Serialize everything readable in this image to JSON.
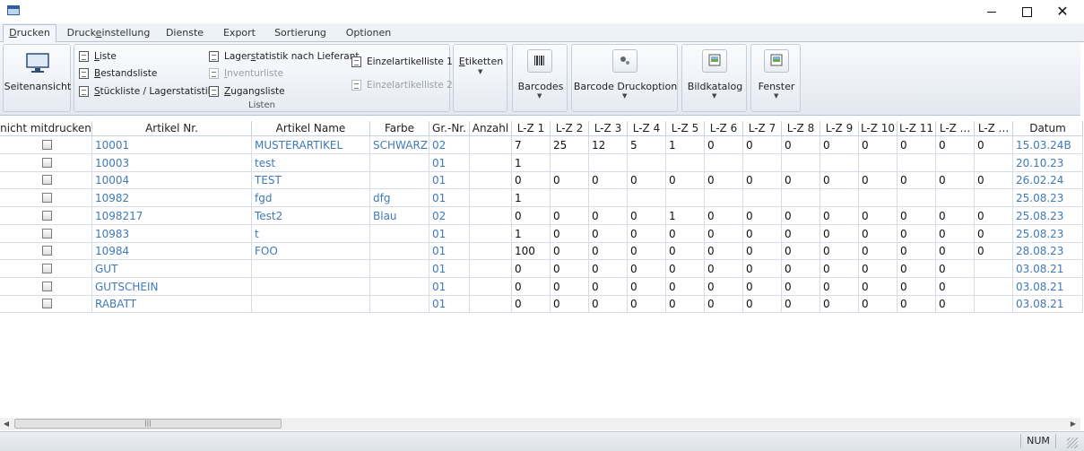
{
  "window": {
    "minimize_glyph": "",
    "maximize_glyph": "",
    "close_glyph": "✕"
  },
  "tabs": [
    {
      "pre": "",
      "ul": "D",
      "post": "rucken"
    },
    {
      "pre": "Druck",
      "ul": "e",
      "post": "instellung"
    },
    {
      "pre": "Dienste",
      "ul": "",
      "post": ""
    },
    {
      "pre": "Export",
      "ul": "",
      "post": ""
    },
    {
      "pre": "Sortierung",
      "ul": "",
      "post": ""
    },
    {
      "pre": "Optionen",
      "ul": "",
      "post": ""
    }
  ],
  "ribbon": {
    "seitenansicht": "Seitenansicht",
    "listen_caption": "Listen",
    "items": [
      {
        "ul": "L",
        "post": "iste"
      },
      {
        "ul": "B",
        "post": "estandsliste"
      },
      {
        "ul": "S",
        "post": "tückliste / Lagerstatistik"
      },
      {
        "pre": "Lager",
        "ul": "s",
        "post": "tatistik nach Lieferant"
      },
      {
        "pre": "",
        "ul": "I",
        "post": "nventurliste"
      },
      {
        "pre": "",
        "ul": "Z",
        "post": "ugangsliste"
      },
      {
        "label": "Einzelartikelliste 1"
      },
      {
        "label": "Einzelartikelliste 2"
      }
    ],
    "etiketten": {
      "pre": "",
      "ul": "E",
      "post": "tiketten"
    },
    "barcodes": "Barcodes",
    "barcode_druckoption": "Barcode Druckoption",
    "bildkatalog": "Bildkatalog",
    "fenster": "Fenster"
  },
  "grid": {
    "columns": [
      "nicht mitdrucken",
      "Artikel Nr.",
      "Artikel Name",
      "Farbe",
      "Gr.-Nr.",
      "Anzahl",
      "L-Z 1",
      "L-Z 2",
      "L-Z 3",
      "L-Z 4",
      "L-Z 5",
      "L-Z 6",
      "L-Z 7",
      "L-Z 8",
      "L-Z 9",
      "L-Z 10",
      "L-Z 11",
      "L-Z ...",
      "L-Z ...",
      "Datum"
    ],
    "rows": [
      [
        "10001",
        "MUSTERARTIKEL",
        "SCHWARZ",
        "02",
        "",
        "7",
        "25",
        "12",
        "5",
        "1",
        "0",
        "0",
        "0",
        "0",
        "0",
        "0",
        "0",
        "0",
        "15.03.24B"
      ],
      [
        "10003",
        "test",
        "",
        "01",
        "",
        "1",
        "",
        "",
        "",
        "",
        "",
        "",
        "",
        "",
        "",
        "",
        "",
        "",
        "20.10.23"
      ],
      [
        "10004",
        "TEST",
        "",
        "01",
        "",
        "0",
        "0",
        "0",
        "0",
        "0",
        "0",
        "0",
        "0",
        "0",
        "0",
        "0",
        "0",
        "0",
        "26.02.24"
      ],
      [
        "10982",
        "fgd",
        "dfg",
        "01",
        "",
        "1",
        "",
        "",
        "",
        "",
        "",
        "",
        "",
        "",
        "",
        "",
        "",
        "",
        "25.08.23"
      ],
      [
        "1098217",
        "Test2",
        "Blau",
        "02",
        "",
        "0",
        "0",
        "0",
        "0",
        "1",
        "0",
        "0",
        "0",
        "0",
        "0",
        "0",
        "0",
        "0",
        "25.08.23"
      ],
      [
        "10983",
        "t",
        "",
        "01",
        "",
        "1",
        "0",
        "0",
        "0",
        "0",
        "0",
        "0",
        "0",
        "0",
        "0",
        "0",
        "0",
        "0",
        "25.08.23"
      ],
      [
        "10984",
        "FOO",
        "",
        "01",
        "",
        "100",
        "0",
        "0",
        "0",
        "0",
        "0",
        "0",
        "0",
        "0",
        "0",
        "0",
        "0",
        "0",
        "28.08.23"
      ],
      [
        "GUT",
        "",
        "",
        "01",
        "",
        "0",
        "0",
        "0",
        "0",
        "0",
        "0",
        "0",
        "0",
        "0",
        "0",
        "0",
        "0",
        "",
        "03.08.21"
      ],
      [
        "GUTSCHEIN",
        "",
        "",
        "01",
        "",
        "0",
        "0",
        "0",
        "0",
        "0",
        "0",
        "0",
        "0",
        "0",
        "0",
        "0",
        "0",
        "",
        "03.08.21"
      ],
      [
        "RABATT",
        "",
        "",
        "01",
        "",
        "0",
        "0",
        "0",
        "0",
        "0",
        "0",
        "0",
        "0",
        "0",
        "0",
        "0",
        "0",
        "",
        "03.08.21"
      ]
    ]
  },
  "scrollbar": {
    "left_arrow": "◀",
    "right_arrow": "▶",
    "thumb_grip": "|||"
  },
  "status": {
    "num": "NUM"
  },
  "colors": {
    "link_blue": "#3f79b9",
    "grid_line": "#d5dce6"
  }
}
